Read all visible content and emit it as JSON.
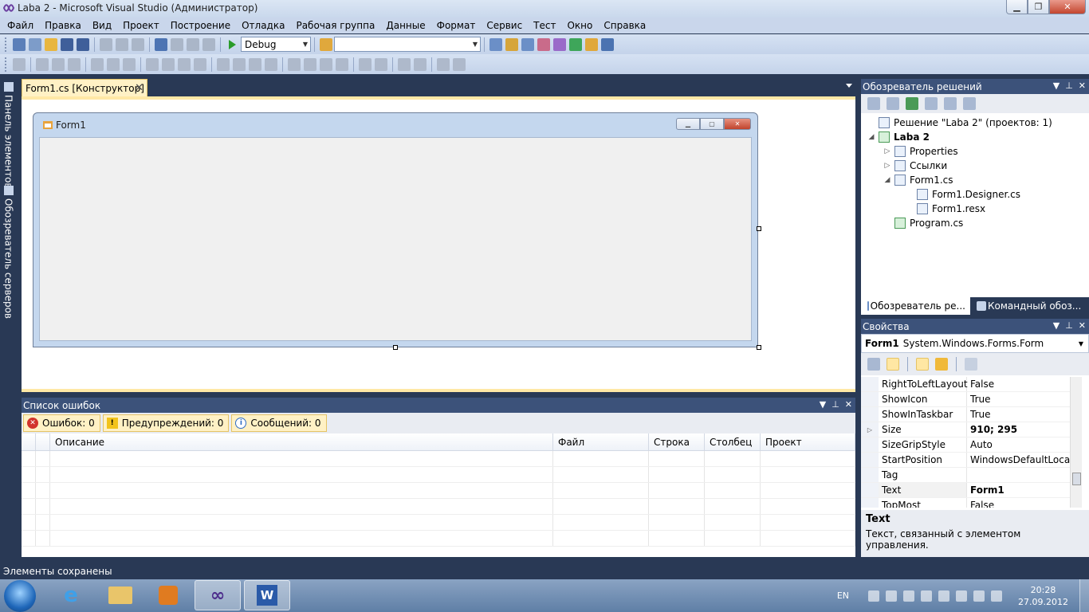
{
  "window": {
    "title": "Laba 2 - Microsoft Visual Studio (Администратор)",
    "minimize_icon": "minimize-icon",
    "maximize_icon": "restore-icon",
    "close_icon": "close-icon"
  },
  "menu": [
    "Файл",
    "Правка",
    "Вид",
    "Проект",
    "Построение",
    "Отладка",
    "Рабочая группа",
    "Данные",
    "Формат",
    "Сервис",
    "Тест",
    "Окно",
    "Справка"
  ],
  "toolbar": {
    "config_value": "Debug",
    "platform_value": ""
  },
  "left_strip": {
    "toolbox": "Панель элементов",
    "server_explorer": "Обозреватель серверов"
  },
  "document": {
    "tab_label": "Form1.cs [Конструктор]",
    "form_title": "Form1"
  },
  "error_list": {
    "title": "Список ошибок",
    "errors": "Ошибок: 0",
    "warnings": "Предупреждений: 0",
    "messages": "Сообщений: 0",
    "columns": {
      "description": "Описание",
      "file": "Файл",
      "line": "Строка",
      "column": "Столбец",
      "project": "Проект"
    }
  },
  "solution_explorer": {
    "title": "Обозреватель решений",
    "tree": [
      {
        "label": "Решение \"Laba 2\"  (проектов: 1)",
        "level": 0,
        "expander": ""
      },
      {
        "label": "Laba 2",
        "level": 0,
        "expander": "◢",
        "bold": true
      },
      {
        "label": "Properties",
        "level": 1,
        "expander": "▷"
      },
      {
        "label": "Ссылки",
        "level": 1,
        "expander": "▷"
      },
      {
        "label": "Form1.cs",
        "level": 1,
        "expander": "◢"
      },
      {
        "label": "Form1.Designer.cs",
        "level": 2,
        "expander": ""
      },
      {
        "label": "Form1.resx",
        "level": 2,
        "expander": ""
      },
      {
        "label": "Program.cs",
        "level": 1,
        "expander": ""
      }
    ],
    "bottom_tabs": [
      "Обозреватель ре...",
      "Командный обоз..."
    ]
  },
  "properties": {
    "title": "Свойства",
    "object_name": "Form1",
    "object_type": "System.Windows.Forms.Form",
    "rows": [
      {
        "name": "RightToLeftLayout",
        "value": "False",
        "expander": "",
        "bold": false
      },
      {
        "name": "ShowIcon",
        "value": "True",
        "expander": "",
        "bold": false
      },
      {
        "name": "ShowInTaskbar",
        "value": "True",
        "expander": "",
        "bold": false
      },
      {
        "name": "Size",
        "value": "910; 295",
        "expander": "▷",
        "bold": true
      },
      {
        "name": "SizeGripStyle",
        "value": "Auto",
        "expander": "",
        "bold": false
      },
      {
        "name": "StartPosition",
        "value": "WindowsDefaultLocatio",
        "expander": "",
        "bold": false
      },
      {
        "name": "Tag",
        "value": "",
        "expander": "",
        "bold": false
      },
      {
        "name": "Text",
        "value": "Form1",
        "expander": "",
        "bold": true
      },
      {
        "name": "TopMost",
        "value": "False",
        "expander": "",
        "bold": false
      }
    ],
    "desc_title": "Text",
    "desc_text": "Текст, связанный с элементом управления."
  },
  "status": {
    "text": "Элементы сохранены"
  },
  "taskbar": {
    "apps": [
      "internet-explorer-icon",
      "file-explorer-icon",
      "media-player-icon",
      "visual-studio-icon",
      "word-icon"
    ],
    "lang": "EN",
    "time": "20:28",
    "date": "27.09.2012"
  }
}
